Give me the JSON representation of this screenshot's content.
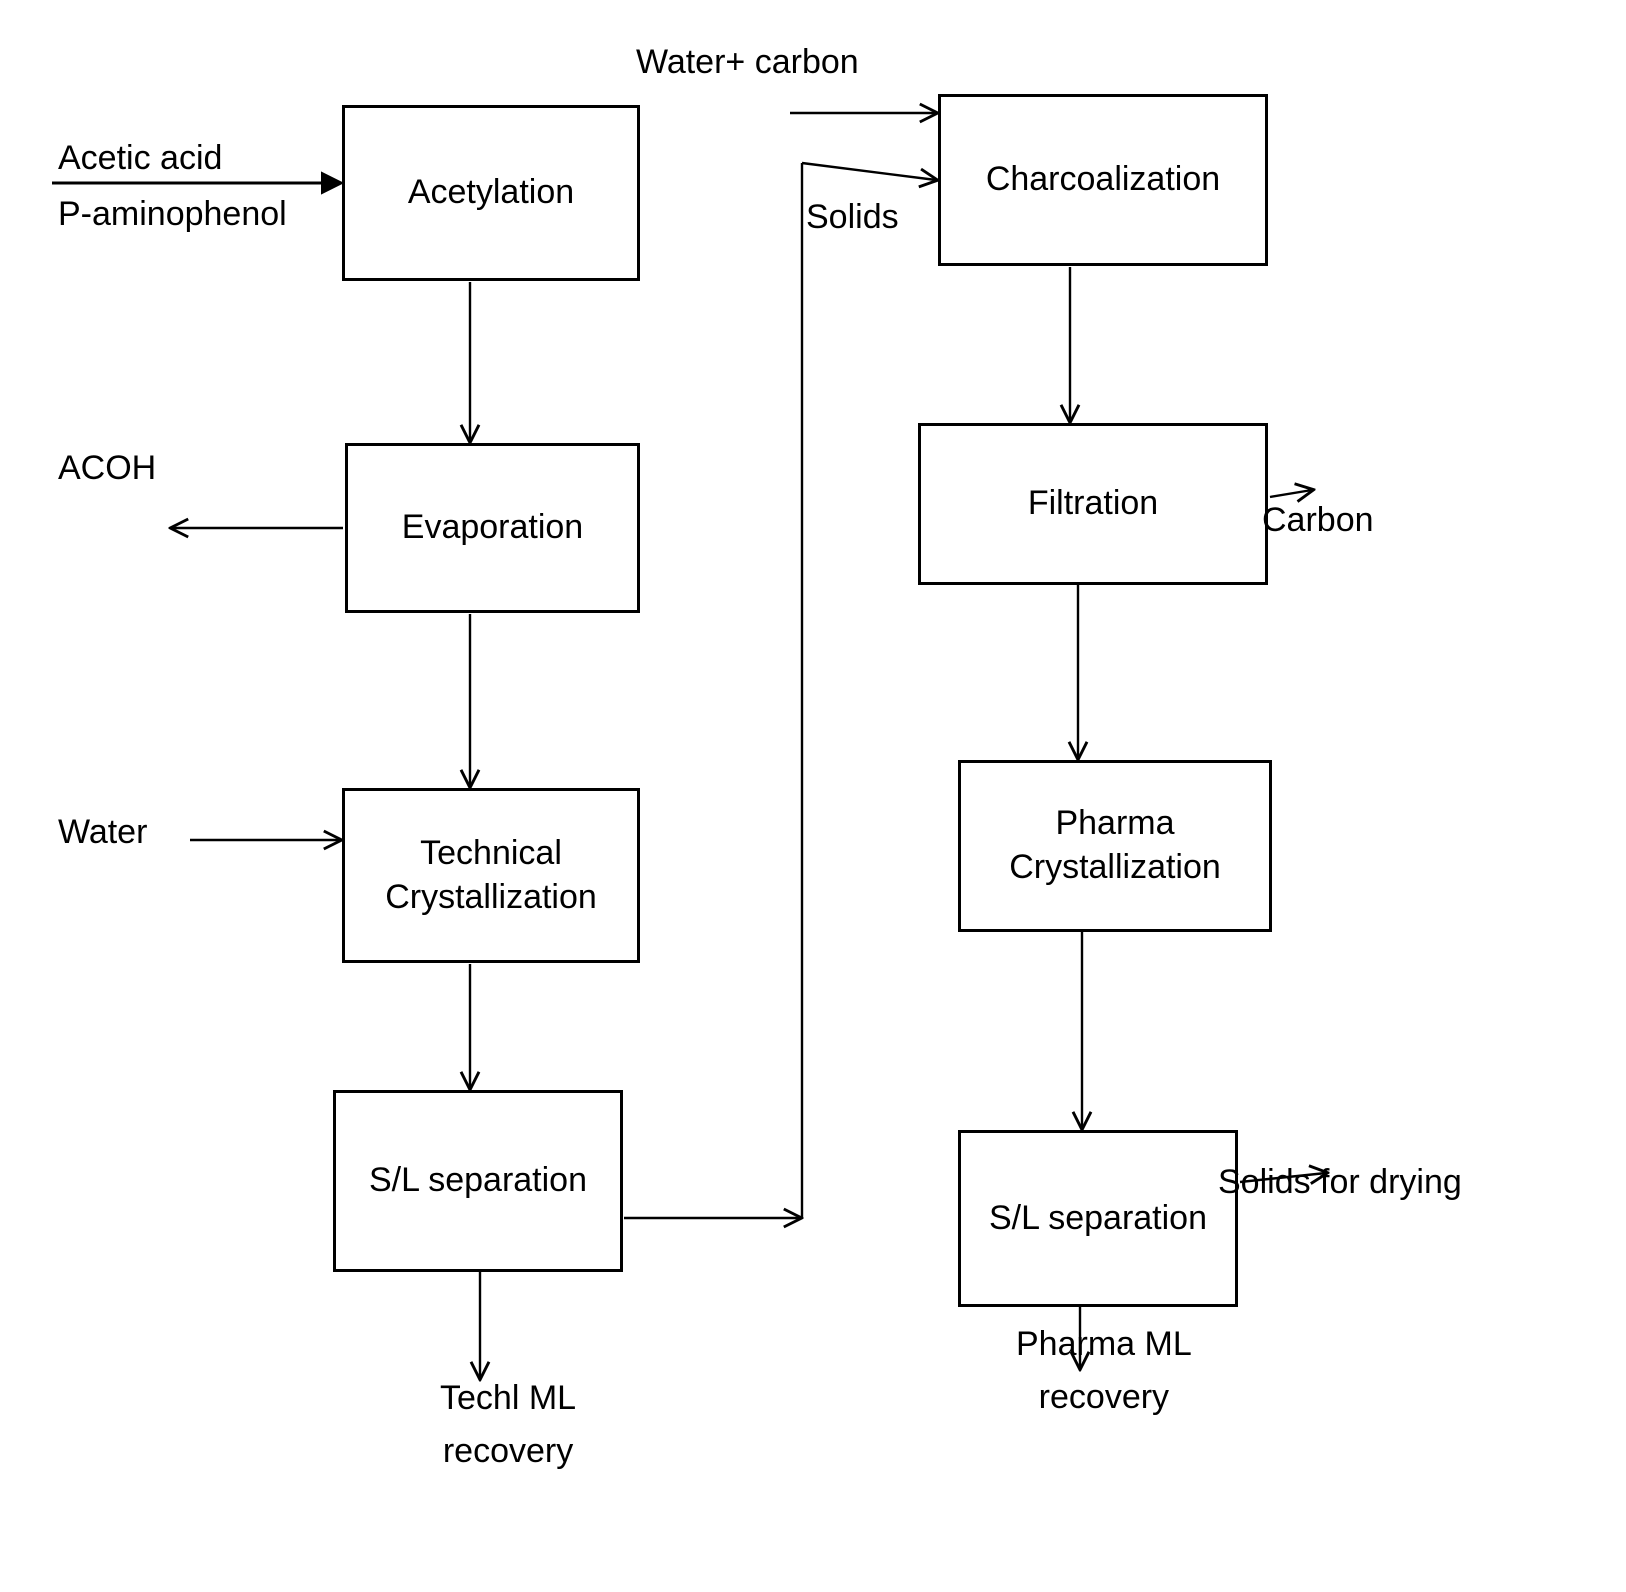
{
  "diagram": {
    "title": "Paracetamol process flow diagram",
    "stroke_color": "#000000",
    "background_color": "#ffffff",
    "nodes": [
      {
        "id": "acetylation",
        "label": "Acetylation"
      },
      {
        "id": "evaporation",
        "label": "Evaporation"
      },
      {
        "id": "tech_cryst",
        "label": "Technical\nCrystallization"
      },
      {
        "id": "sl_sep_left",
        "label": "S/L separation"
      },
      {
        "id": "charcoalization",
        "label": "Charcoalization"
      },
      {
        "id": "filtration",
        "label": "Filtration"
      },
      {
        "id": "pharma_cryst",
        "label": "Pharma\nCrystallization"
      },
      {
        "id": "sl_sep_right",
        "label": "S/L separation"
      }
    ],
    "stream_labels": {
      "acetic_acid": "Acetic acid",
      "p_aminophenol": "P-aminophenol",
      "water_carbon": "Water+ carbon",
      "acoh": "ACOH",
      "solids": "Solids",
      "water": "Water",
      "carbon": "Carbon",
      "techl_ml_recovery": "Techl ML\nrecovery",
      "pharma_ml_recovery": "Pharma ML\nrecovery",
      "solids_for_drying": "Solids for drying"
    }
  }
}
